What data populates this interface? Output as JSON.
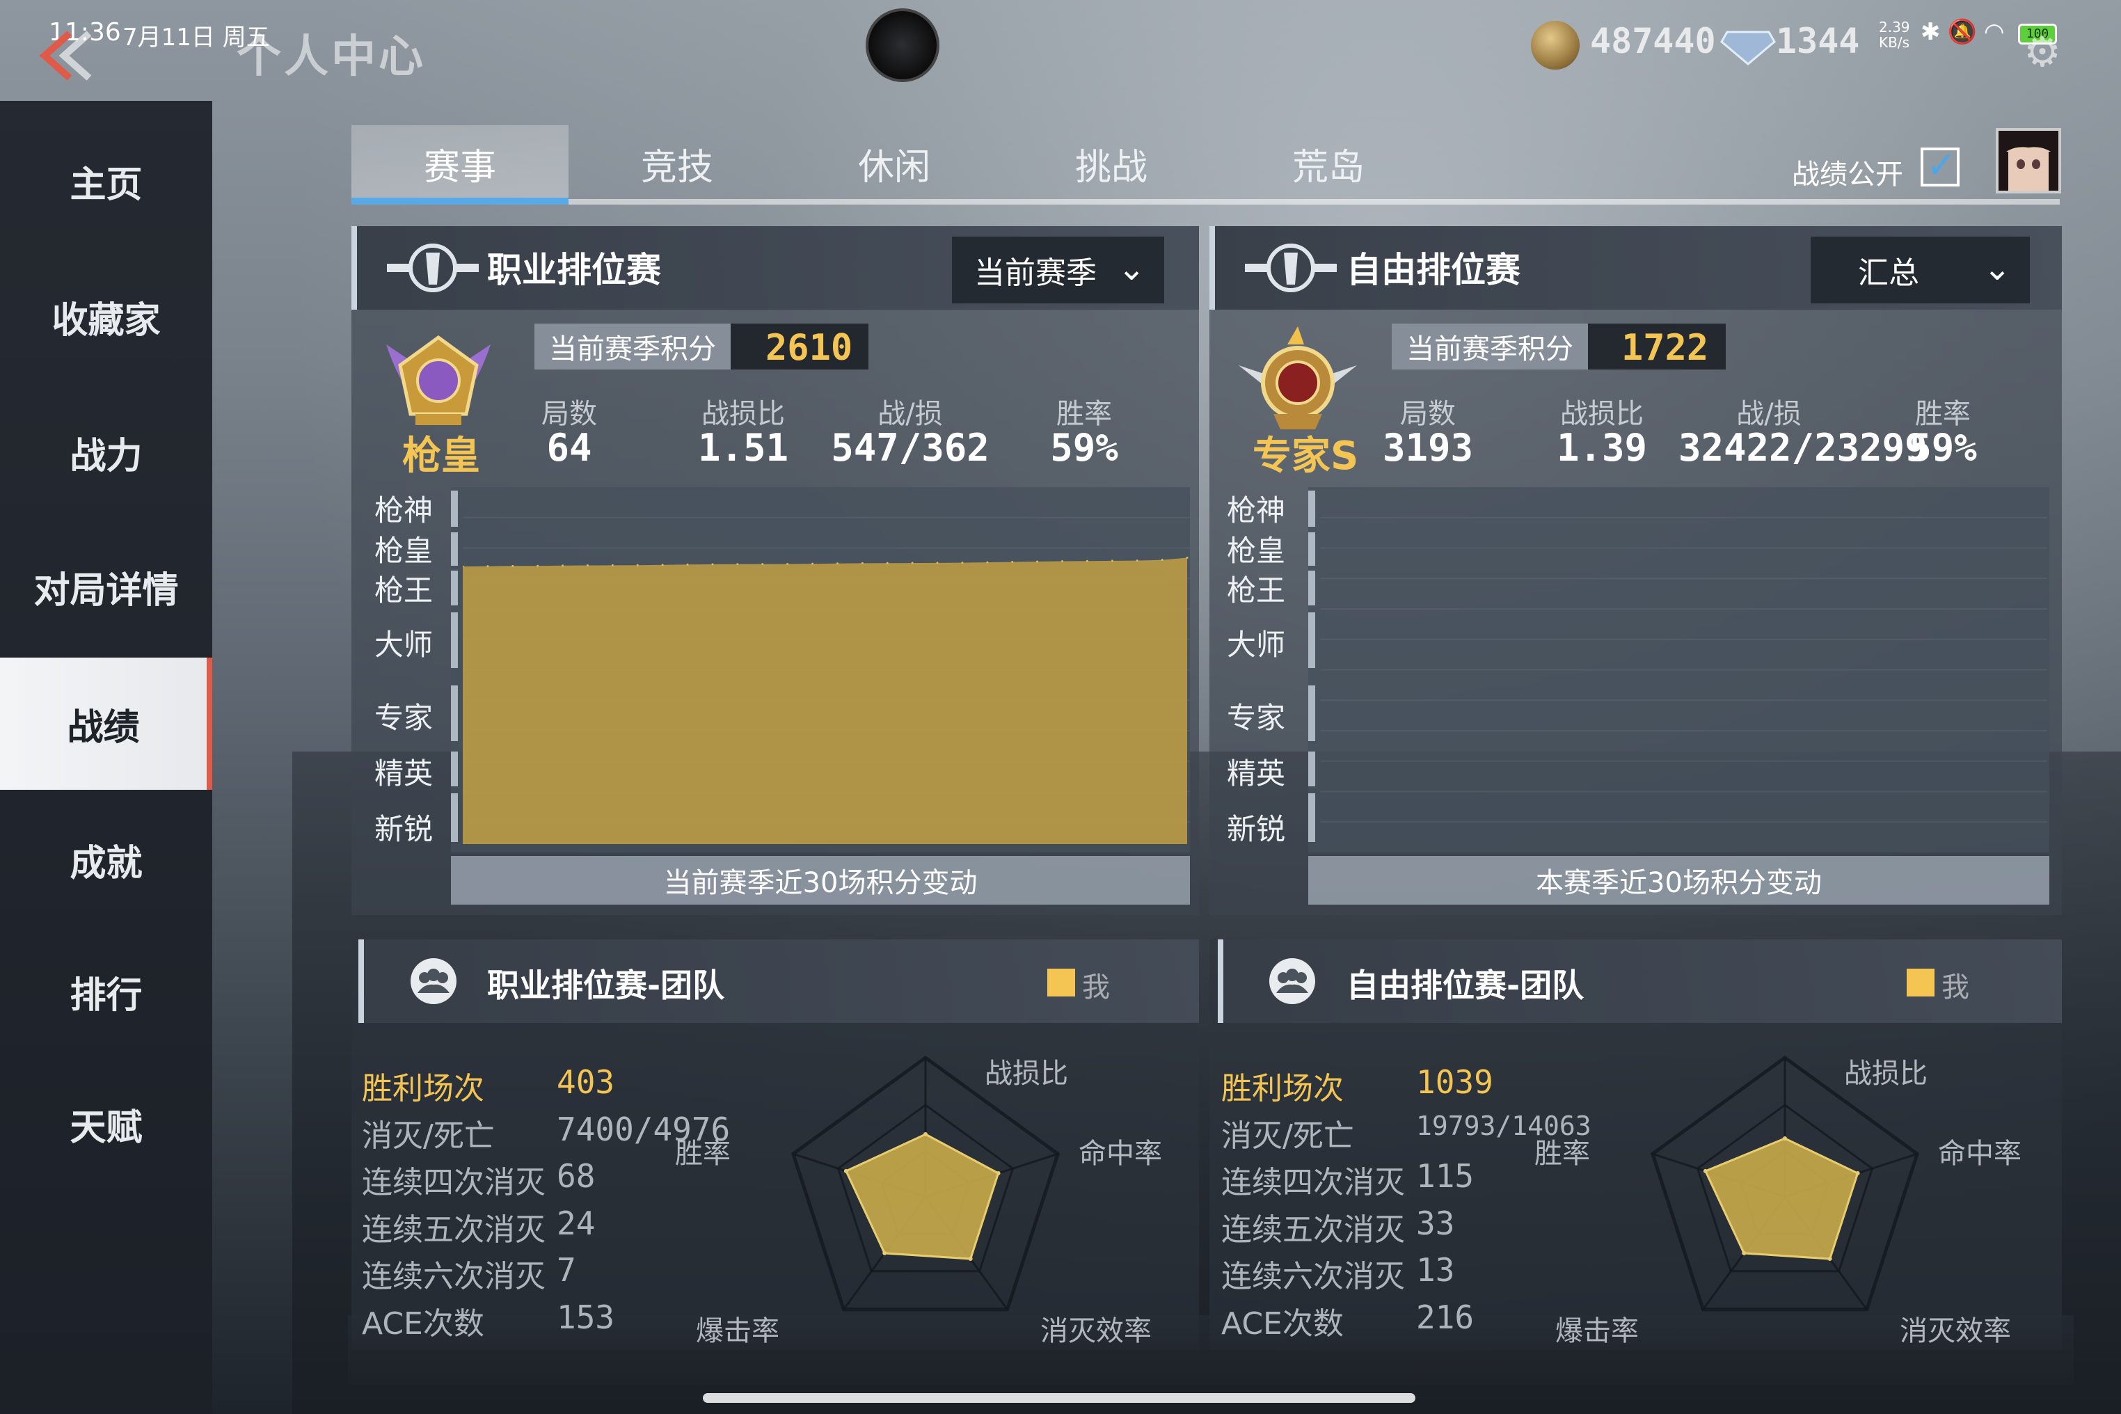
{
  "status": {
    "time": "11:36",
    "date": "7月11日 周五",
    "net_speed": "2.39 KB/s",
    "battery": "100"
  },
  "header": {
    "title": "个人中心",
    "coins": "487440",
    "diamonds": "1344"
  },
  "sidebar": {
    "items": [
      {
        "label": "主页"
      },
      {
        "label": "收藏家"
      },
      {
        "label": "战力"
      },
      {
        "label": "对局详情"
      },
      {
        "label": "战绩"
      },
      {
        "label": "成就"
      },
      {
        "label": "排行"
      },
      {
        "label": "天赋"
      }
    ],
    "active_index": 4
  },
  "tabs": {
    "items": [
      {
        "label": "赛事"
      },
      {
        "label": "竞技"
      },
      {
        "label": "休闲"
      },
      {
        "label": "挑战"
      },
      {
        "label": "荒岛"
      }
    ],
    "active_index": 0,
    "record_public_label": "战绩公开",
    "record_public_checked": true
  },
  "colors": {
    "accent_gold": "#f4c552",
    "active_tab_underline": "#5aa9e6",
    "sidebar_active_border": "#e05a4a"
  },
  "pro_ranked": {
    "title": "职业排位赛",
    "dropdown": "当前赛季",
    "rank_name": "枪皇",
    "score_label": "当前赛季积分",
    "score": "2610",
    "stats": [
      {
        "label": "局数",
        "value": "64"
      },
      {
        "label": "战损比",
        "value": "1.51"
      },
      {
        "label": "战/损",
        "value": "547/362"
      },
      {
        "label": "胜率",
        "value": "59%"
      }
    ],
    "chart_footer": "当前赛季近30场积分变动"
  },
  "free_ranked": {
    "title": "自由排位赛",
    "dropdown": "汇总",
    "rank_name": "专家S",
    "score_label": "当前赛季积分",
    "score": "1722",
    "stats": [
      {
        "label": "局数",
        "value": "3193"
      },
      {
        "label": "战损比",
        "value": "1.39"
      },
      {
        "label": "战/损",
        "value": "32422/23299"
      },
      {
        "label": "胜率",
        "value": "59%"
      }
    ],
    "chart_footer": "本赛季近30场积分变动"
  },
  "rank_axis": [
    "枪神",
    "枪皇",
    "枪王",
    "大师",
    "专家",
    "精英",
    "新锐"
  ],
  "chart_data": [
    {
      "type": "area",
      "y_categories": [
        "新锐",
        "精英",
        "专家",
        "大师",
        "枪王",
        "枪皇",
        "枪神"
      ],
      "x": [
        1,
        2,
        3,
        4,
        5,
        6,
        7,
        8,
        9,
        10,
        11,
        12,
        13,
        14,
        15,
        16,
        17,
        18,
        19,
        20,
        21,
        22,
        23,
        24,
        25,
        26,
        27,
        28,
        29,
        30
      ],
      "values": [
        2530,
        2532,
        2535,
        2536,
        2538,
        2540,
        2541,
        2542,
        2545,
        2548,
        2550,
        2551,
        2552,
        2553,
        2555,
        2558,
        2560,
        2561,
        2562,
        2563,
        2565,
        2568,
        2572,
        2575,
        2578,
        2580,
        2582,
        2584,
        2590,
        2610
      ],
      "ylim": [
        0,
        3000
      ],
      "color": "#b89a45",
      "xlabel": "当前赛季近30场积分变动"
    },
    {
      "type": "area",
      "y_categories": [
        "新锐",
        "精英",
        "专家",
        "大师",
        "枪王",
        "枪皇",
        "枪神"
      ],
      "x": [],
      "values": [],
      "ylim": [
        0,
        3000
      ],
      "xlabel": "本赛季近30场积分变动"
    },
    {
      "type": "radar",
      "title": "职业排位赛-团队",
      "axes": [
        "战损比",
        "命中率",
        "消灭效率",
        "爆击率",
        "胜率"
      ],
      "series": [
        {
          "name": "我",
          "values": [
            0.45,
            0.55,
            0.55,
            0.5,
            0.6
          ]
        }
      ],
      "max": 1
    },
    {
      "type": "radar",
      "title": "自由排位赛-团队",
      "axes": [
        "战损比",
        "命中率",
        "消灭效率",
        "爆击率",
        "胜率"
      ],
      "series": [
        {
          "name": "我",
          "values": [
            0.42,
            0.55,
            0.55,
            0.5,
            0.6
          ]
        }
      ],
      "max": 1
    }
  ],
  "pro_team": {
    "title": "职业排位赛-团队",
    "legend": "我",
    "stats": [
      {
        "label": "胜利场次",
        "value": "403"
      },
      {
        "label": "消灭/死亡",
        "value": "7400/4976"
      },
      {
        "label": "连续四次消灭",
        "value": "68"
      },
      {
        "label": "连续五次消灭",
        "value": "24"
      },
      {
        "label": "连续六次消灭",
        "value": "7"
      },
      {
        "label": "ACE次数",
        "value": "153"
      }
    ],
    "radar_labels": [
      "战损比",
      "命中率",
      "消灭效率",
      "爆击率",
      "胜率"
    ]
  },
  "free_team": {
    "title": "自由排位赛-团队",
    "legend": "我",
    "stats": [
      {
        "label": "胜利场次",
        "value": "1039"
      },
      {
        "label": "消灭/死亡",
        "value": "19793/14063"
      },
      {
        "label": "连续四次消灭",
        "value": "115"
      },
      {
        "label": "连续五次消灭",
        "value": "33"
      },
      {
        "label": "连续六次消灭",
        "value": "13"
      },
      {
        "label": "ACE次数",
        "value": "216"
      }
    ],
    "radar_labels": [
      "战损比",
      "命中率",
      "消灭效率",
      "爆击率",
      "胜率"
    ]
  }
}
